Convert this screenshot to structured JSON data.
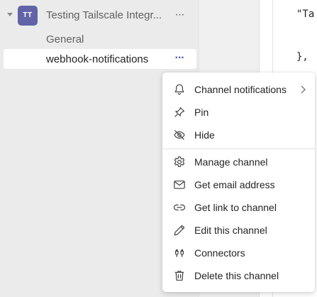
{
  "sidebar": {
    "team": {
      "avatar_initials": "TT",
      "name": "Testing Tailscale Integr...",
      "more_label": "···"
    },
    "channels": [
      {
        "label": "General"
      },
      {
        "label": "webhook-notifications",
        "more_label": "···"
      }
    ]
  },
  "code": {
    "lines": [
      "\"Ta",
      "},"
    ]
  },
  "context_menu": {
    "items": [
      {
        "label": "Channel notifications",
        "icon": "bell-icon",
        "has_submenu": true
      },
      {
        "label": "Pin",
        "icon": "pin-icon"
      },
      {
        "label": "Hide",
        "icon": "eye-hidden-icon"
      },
      {
        "label": "Manage channel",
        "icon": "gear-icon"
      },
      {
        "label": "Get email address",
        "icon": "mail-icon"
      },
      {
        "label": "Get link to channel",
        "icon": "link-icon"
      },
      {
        "label": "Edit this channel",
        "icon": "pencil-icon"
      },
      {
        "label": "Connectors",
        "icon": "plug-icon"
      },
      {
        "label": "Delete this channel",
        "icon": "trash-icon"
      }
    ]
  },
  "colors": {
    "accent": "#4f52b2",
    "avatar": "#6264a7"
  }
}
